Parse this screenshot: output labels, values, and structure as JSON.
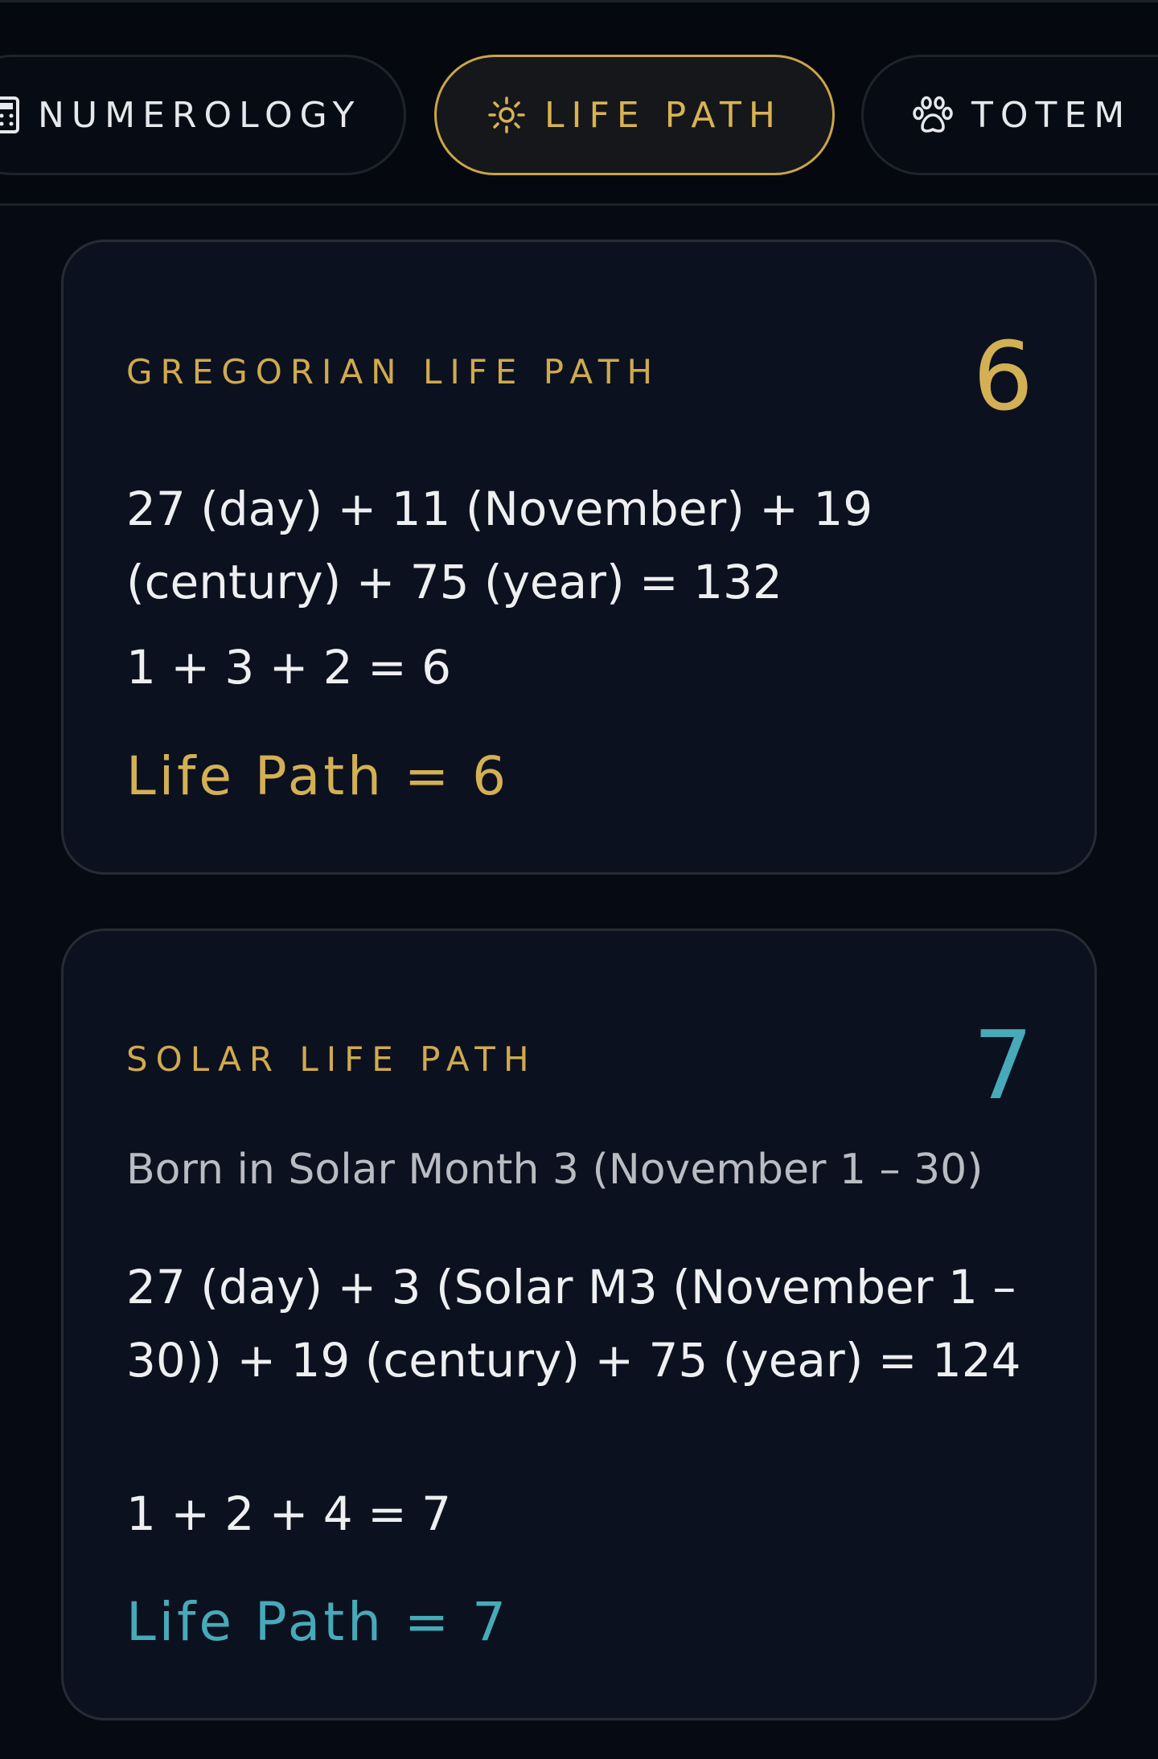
{
  "tabs": [
    {
      "label": "NUMEROLOGY",
      "icon": "calculator-icon",
      "active": false
    },
    {
      "label": "LIFE PATH",
      "icon": "sun-icon",
      "active": true
    },
    {
      "label": "TOTEM",
      "icon": "paw-icon",
      "active": false
    }
  ],
  "gregorian": {
    "label": "GREGORIAN LIFE PATH",
    "number": "6",
    "equation": "27 (day) + 11 (November) + 19 (century) + 75 (year) = 132",
    "reduction": "1 + 3 + 2 = 6",
    "result": "Life Path = 6"
  },
  "solar": {
    "label": "SOLAR LIFE PATH",
    "number": "7",
    "subtitle": "Born in Solar Month 3 (November 1 – 30)",
    "equation": "27 (day) + 3 (Solar M3 (November 1 – 30)) + 19 (century) + 75 (year) = 124",
    "reduction": "1 + 2 + 4 = 7",
    "result": "Life Path = 7"
  },
  "colors": {
    "background": "#060a12",
    "card": "#0c1120",
    "gold": "#d3b054",
    "teal": "#47aab8"
  }
}
